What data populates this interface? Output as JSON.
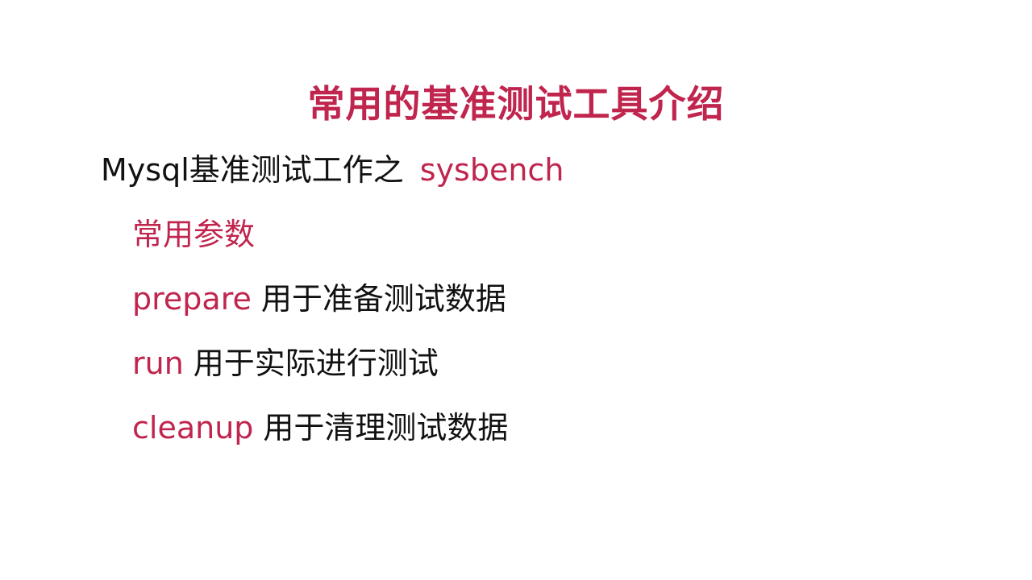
{
  "slide": {
    "title": "常用的基准测试工具介绍",
    "subtitle": {
      "text": "Mysql基准测试工作之",
      "tool": "sysbench"
    },
    "params_heading": "常用参数",
    "params": [
      {
        "keyword": "prepare",
        "description": "用于准备测试数据"
      },
      {
        "keyword": "run",
        "description": "用于实际进行测试"
      },
      {
        "keyword": "cleanup",
        "description": "用于清理测试数据"
      }
    ]
  },
  "colors": {
    "accent": "#c0254e",
    "text": "#111111",
    "background": "#ffffff"
  }
}
